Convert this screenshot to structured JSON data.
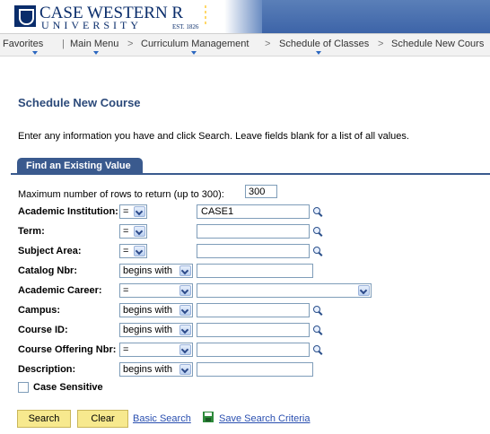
{
  "header": {
    "logo_name": "CASE WESTERN R",
    "logo_sub": "UNIVERSITY",
    "logo_est": "EST. 1826"
  },
  "nav": {
    "favorites": "Favorites",
    "main_menu": "Main Menu",
    "curriculum": "Curriculum Management",
    "schedule_classes": "Schedule of Classes",
    "schedule_new": "Schedule New Cours",
    "separator": ">",
    "pipe": "|"
  },
  "page": {
    "title": "Schedule New Course",
    "instructions": "Enter any information you have and click Search. Leave fields blank for a list of all values.",
    "tab": "Find an Existing Value",
    "max_rows_label": "Maximum number of rows to return (up to 300):",
    "max_rows_value": "300"
  },
  "fields": [
    {
      "label": "Academic Institution:",
      "op": "=",
      "value": "CASE1"
    },
    {
      "label": "Term:",
      "op": "=",
      "value": ""
    },
    {
      "label": "Subject Area:",
      "op": "=",
      "value": ""
    },
    {
      "label": "Catalog Nbr:",
      "op": "begins with",
      "value": ""
    },
    {
      "label": "Academic Career:",
      "op": "=",
      "value": ""
    },
    {
      "label": "Campus:",
      "op": "begins with",
      "value": ""
    },
    {
      "label": "Course ID:",
      "op": "begins with",
      "value": ""
    },
    {
      "label": "Course Offering Nbr:",
      "op": "=",
      "value": ""
    },
    {
      "label": "Description:",
      "op": "begins with",
      "value": ""
    }
  ],
  "case_sensitive": {
    "label": "Case Sensitive",
    "checked": false
  },
  "actions": {
    "search": "Search",
    "clear": "Clear",
    "basic_search": "Basic Search",
    "save_criteria": "Save Search Criteria"
  }
}
